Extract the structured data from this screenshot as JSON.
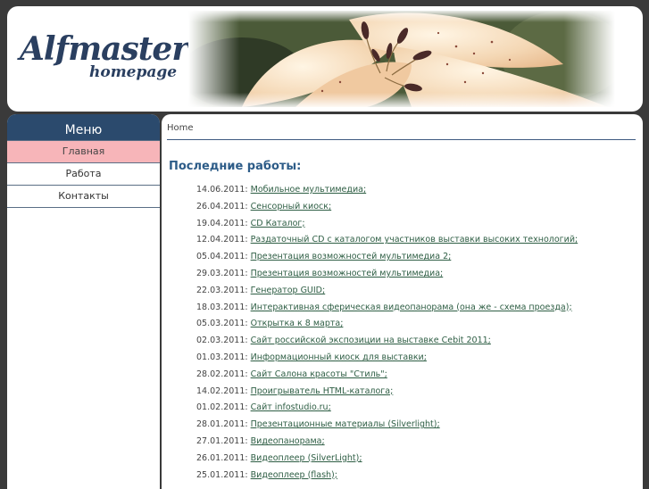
{
  "header": {
    "logo_main": "Alfmaster",
    "logo_sub": "homepage"
  },
  "sidebar": {
    "title": "Меню",
    "items": [
      {
        "label": "Главная",
        "active": true
      },
      {
        "label": "Работа",
        "active": false
      },
      {
        "label": "Контакты",
        "active": false
      }
    ]
  },
  "content": {
    "breadcrumb": "Home",
    "section_title": "Последние работы:",
    "works": [
      {
        "date": "14.06.2011:",
        "title": "Мобильное мультимедиа;"
      },
      {
        "date": "26.04.2011:",
        "title": "Сенсорный киоск;"
      },
      {
        "date": "19.04.2011:",
        "title": "CD Каталог;"
      },
      {
        "date": "12.04.2011:",
        "title": "Раздаточный CD с каталогом участников выставки высоких технологий;"
      },
      {
        "date": "05.04.2011:",
        "title": "Презентация возможностей мультимедиа 2;"
      },
      {
        "date": "29.03.2011:",
        "title": "Презентация возможностей мультимедиа;"
      },
      {
        "date": "22.03.2011:",
        "title": "Генератор GUID;"
      },
      {
        "date": "18.03.2011:",
        "title": "Интерактивная сферическая видеопанорама (она же - схема проезда);"
      },
      {
        "date": "05.03.2011:",
        "title": "Открытка к 8 марта;"
      },
      {
        "date": "02.03.2011:",
        "title": "Сайт российской экспозиции на выставке Cebit 2011;"
      },
      {
        "date": "01.03.2011:",
        "title": "Информационный киоск для выставки;"
      },
      {
        "date": "28.02.2011:",
        "title": "Сайт Салона красоты \"Стиль\";"
      },
      {
        "date": "14.02.2011:",
        "title": "Проигрыватель HTML-каталога;"
      },
      {
        "date": "01.02.2011:",
        "title": "Сайт infostudio.ru;"
      },
      {
        "date": "28.01.2011:",
        "title": "Презентационные материалы (Silverlight);"
      },
      {
        "date": "27.01.2011:",
        "title": "Видеопанорама;"
      },
      {
        "date": "26.01.2011:",
        "title": "Видеоплеер (SilverLight);"
      },
      {
        "date": "25.01.2011:",
        "title": "Видеоплеер (flash);"
      }
    ]
  },
  "colors": {
    "menu_header": "#2b4a6d",
    "menu_active": "#f7b5b9",
    "link": "#2e5e44",
    "section_title": "#2d5c88",
    "background": "#3a3a3a"
  }
}
